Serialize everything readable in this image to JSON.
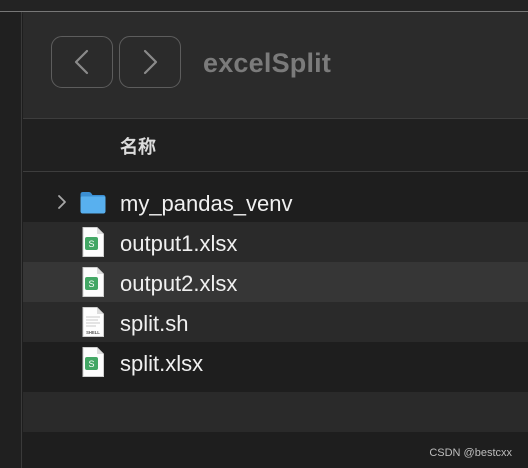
{
  "window": {
    "title": "excelSplit"
  },
  "toolbar": {
    "back_icon": "chevron-left-icon",
    "forward_icon": "chevron-right-icon"
  },
  "table": {
    "column_name": "名称"
  },
  "files": [
    {
      "name": "my_pandas_venv",
      "kind": "folder",
      "icon": "folder-icon",
      "expandable": true
    },
    {
      "name": "output1.xlsx",
      "kind": "spreadsheet",
      "icon": "xlsx-file-icon"
    },
    {
      "name": "output2.xlsx",
      "kind": "spreadsheet",
      "icon": "xlsx-file-icon",
      "selected": true
    },
    {
      "name": "split.sh",
      "kind": "shell-script",
      "icon": "shell-script-icon",
      "icon_label": "SHELL"
    },
    {
      "name": "split.xlsx",
      "kind": "spreadsheet",
      "icon": "xlsx-file-icon"
    }
  ],
  "colors": {
    "folder": "#4ea4e8",
    "xlsx_badge": "#43a765",
    "selection": "#363636"
  },
  "watermark": "CSDN @bestcxx"
}
